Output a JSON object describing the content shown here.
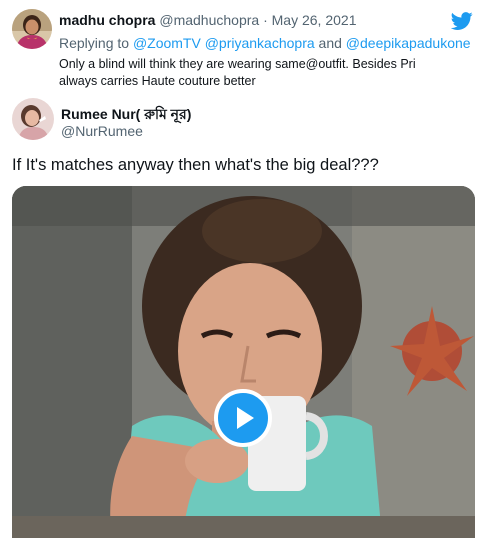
{
  "reply_tweet": {
    "display_name": "madhu chopra",
    "handle": "@madhuchopra",
    "separator": "·",
    "date": "May 26, 2021",
    "replying_prefix": "Replying to",
    "replying_to": [
      "@ZoomTV",
      "@priyankachopra",
      "@deepikapadukone"
    ],
    "replying_and": "and",
    "body": "Only a blind will think they are wearing same@outfit. Besides Pri always carries Haute couture better",
    "avatar_icon": "woman-portrait-avatar"
  },
  "main_tweet": {
    "display_name": "Rumee Nur( রুমি নূর)",
    "handle": "@NurRumee",
    "text": "If It's matches anyway then what's the big deal???",
    "avatar_icon": "woman-portrait-avatar",
    "media": {
      "type": "gif-video",
      "play_icon": "play-icon"
    }
  },
  "brand": {
    "logo_icon": "twitter-bird-icon",
    "accent": "#1d9bf0"
  }
}
